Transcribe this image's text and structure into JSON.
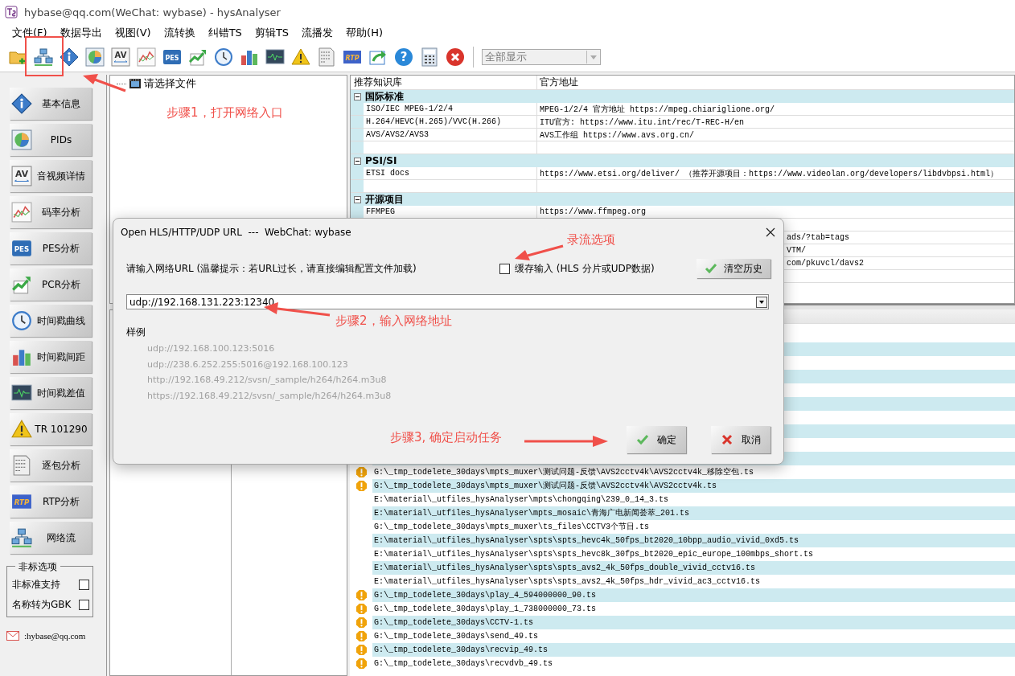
{
  "window": {
    "title": "hybase@qq.com(WeChat: wybase) - hysAnalyser"
  },
  "menu": [
    "文件(F)",
    "数据导出",
    "视图(V)",
    "流转换",
    "纠错TS",
    "剪辑TS",
    "流播发",
    "帮助(H)"
  ],
  "toolbar": {
    "buttons": [
      {
        "kind": "folder"
      },
      {
        "kind": "network"
      },
      {
        "kind": "info"
      },
      {
        "kind": "pie"
      },
      {
        "kind": "av",
        "glyph": "AV"
      },
      {
        "kind": "linechart"
      },
      {
        "kind": "pes",
        "glyph": "PES"
      },
      {
        "kind": "trend"
      },
      {
        "kind": "clock"
      },
      {
        "kind": "bars"
      },
      {
        "kind": "monitor"
      },
      {
        "kind": "warning"
      },
      {
        "kind": "binary"
      },
      {
        "kind": "rtp",
        "glyph": "RTP"
      },
      {
        "kind": "export"
      },
      {
        "kind": "help",
        "glyph": "?"
      },
      {
        "kind": "calculator"
      },
      {
        "kind": "close"
      }
    ],
    "filter": {
      "value": "全部显示",
      "disabled": true
    }
  },
  "sidebar": {
    "buttons": [
      {
        "kind": "info",
        "label": "基本信息"
      },
      {
        "kind": "pie",
        "label": "PIDs"
      },
      {
        "kind": "av",
        "glyph": "AV",
        "label": "音视频详情"
      },
      {
        "kind": "linechart",
        "label": "码率分析"
      },
      {
        "kind": "pes",
        "glyph": "PES",
        "label": "PES分析"
      },
      {
        "kind": "trend",
        "label": "PCR分析"
      },
      {
        "kind": "clock",
        "label": "时间戳曲线"
      },
      {
        "kind": "bars",
        "label": "时间戳间距"
      },
      {
        "kind": "monitor",
        "label": "时间戳差值"
      },
      {
        "kind": "warning",
        "label": "TR 101290"
      },
      {
        "kind": "binary",
        "label": "逐包分析"
      },
      {
        "kind": "rtp",
        "glyph": "RTP",
        "label": "RTP分析"
      },
      {
        "kind": "network",
        "label": "网络流"
      }
    ],
    "options": {
      "title": "非标选项",
      "items": [
        {
          "label": "非标准支持",
          "checked": false
        },
        {
          "label": "名称转为GBK",
          "checked": false
        }
      ]
    },
    "contact": ":hybase@qq.com"
  },
  "tree": {
    "root": "请选择文件"
  },
  "knowledge": {
    "columns": [
      "推荐知识库",
      "官方地址"
    ],
    "groups": [
      {
        "title": "国际标准",
        "expanded": true,
        "rows": [
          {
            "kind": "entry",
            "name": "ISO/IEC MPEG-1/2/4",
            "url": "MPEG-1/2/4 官方地址 https://mpeg.chiariglione.org/"
          },
          {
            "kind": "entry",
            "name": "H.264/HEVC(H.265)/VVC(H.266)",
            "url": "ITU官方: https://www.itu.int/rec/T-REC-H/en"
          },
          {
            "kind": "entry",
            "name": "AVS/AVS2/AVS3",
            "url": "AVS工作组  https://www.avs.org.cn/"
          },
          {
            "kind": "blank"
          }
        ]
      },
      {
        "title": "PSI/SI",
        "expanded": true,
        "rows": [
          {
            "kind": "entry",
            "name": "ETSI docs",
            "url": "https://www.etsi.org/deliver/ （推荐开源项目：https://www.videolan.org/developers/libdvbpsi.html）"
          },
          {
            "kind": "blank"
          }
        ]
      },
      {
        "title": "开源项目",
        "expanded": true,
        "rows": [
          {
            "kind": "entry",
            "name": "FFMPEG",
            "url": "https://www.ffmpeg.org"
          },
          {
            "kind": "blank"
          },
          {
            "kind": "partial",
            "url": "ads/?tab=tags"
          },
          {
            "kind": "partial",
            "url": "VTM/"
          },
          {
            "kind": "partial",
            "url": "com/pkuvcl/davs2"
          },
          {
            "kind": "blank"
          }
        ]
      }
    ]
  },
  "files": [
    {
      "path": "G:\\_tmp_todelete_30days\\mpts_muxer\\测试问题-反馈\\AVS2cctv4k\\AVS2cctv4k_移除空包.ts",
      "warning": true
    },
    {
      "path": "G:\\_tmp_todelete_30days\\mpts_muxer\\测试问题-反馈\\AVS2cctv4k\\AVS2cctv4k.ts",
      "warning": true
    },
    {
      "path": "E:\\material\\_utfiles_hysAnalyser\\mpts\\chongqing\\239_0_14_3.ts",
      "warning": false
    },
    {
      "path": "E:\\material\\_utfiles_hysAnalyser\\mpts_mosaic\\青海广电新闻荟萃_201.ts",
      "warning": false
    },
    {
      "path": "G:\\_tmp_todelete_30days\\mpts_muxer\\ts_files\\CCTV3个节目.ts",
      "warning": false
    },
    {
      "path": "E:\\material\\_utfiles_hysAnalyser\\spts\\spts_hevc4k_50fps_bt2020_10bpp_audio_vivid_0xd5.ts",
      "warning": false
    },
    {
      "path": "E:\\material\\_utfiles_hysAnalyser\\spts\\spts_hevc8k_30fps_bt2020_epic_europe_100mbps_short.ts",
      "warning": false
    },
    {
      "path": "E:\\material\\_utfiles_hysAnalyser\\spts\\spts_avs2_4k_50fps_double_vivid_cctv16.ts",
      "warning": false
    },
    {
      "path": "E:\\material\\_utfiles_hysAnalyser\\spts\\spts_avs2_4k_50fps_hdr_vivid_ac3_cctv16.ts",
      "warning": false
    },
    {
      "path": "G:\\_tmp_todelete_30days\\play_4_594000000_90.ts",
      "warning": true
    },
    {
      "path": "G:\\_tmp_todelete_30days\\play_1_738000000_73.ts",
      "warning": true
    },
    {
      "path": "G:\\_tmp_todelete_30days\\CCTV-1.ts",
      "warning": true
    },
    {
      "path": "G:\\_tmp_todelete_30days\\send_49.ts",
      "warning": true
    },
    {
      "path": "G:\\_tmp_todelete_30days\\recvip_49.ts",
      "warning": true
    },
    {
      "path": "G:\\_tmp_todelete_30days\\recvdvb_49.ts",
      "warning": true
    }
  ],
  "dialog": {
    "title": "Open HLS/HTTP/UDP URL  ---  WebChat: wybase",
    "prompt": "请输入网络URL (温馨提示：若URL过长，请直接编辑配置文件加载)",
    "cache": {
      "label": "缓存输入 (HLS 分片或UDP数据)",
      "checked": false
    },
    "clear_button": "清空历史",
    "url": {
      "value": "udp://192.168.131.223:12340"
    },
    "examples_title": "样例",
    "examples": [
      "udp://192.168.100.123:5016",
      "udp://238.6.252.255:5016@192.168.100.123",
      "http://192.168.49.212/svsn/_sample/h264/h264.m3u8",
      "https://192.168.49.212/svsn/_sample/h264/h264.m3u8"
    ],
    "ok_button": "确定",
    "cancel_button": "取消"
  },
  "annotations": [
    "步骤1，打开网络入口",
    "录流选项",
    "步骤2，输入网络地址",
    "步骤3, 确定启动任务"
  ]
}
